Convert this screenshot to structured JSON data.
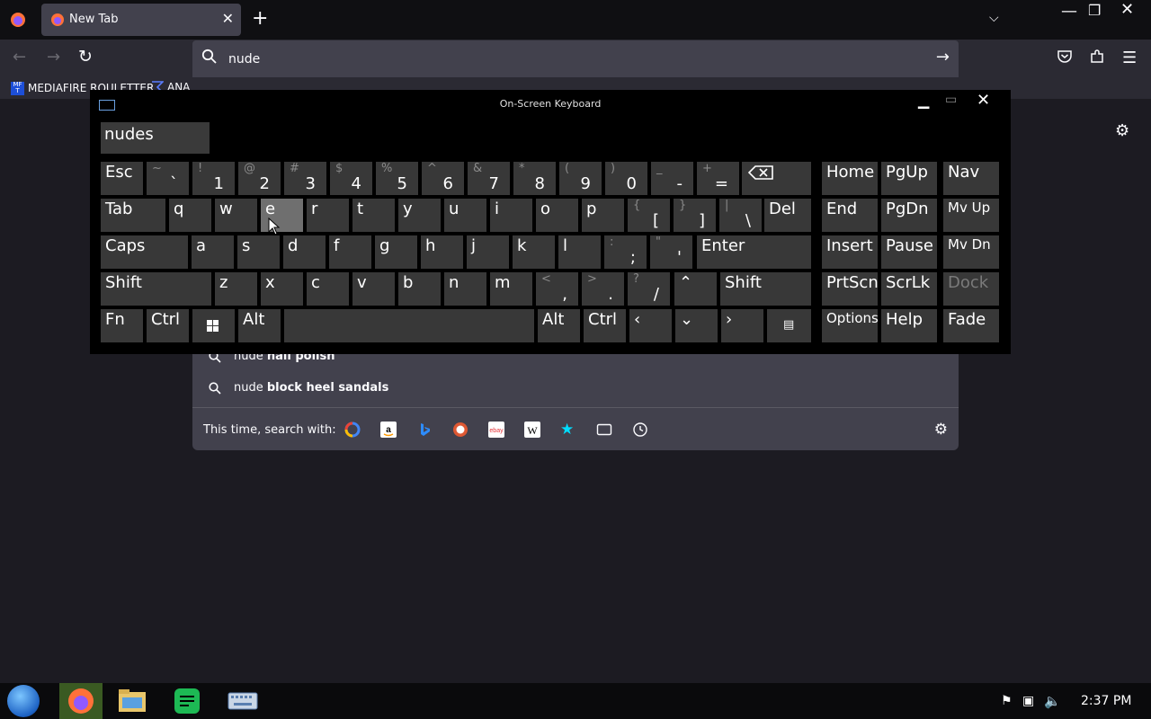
{
  "browser": {
    "tab_title": "New Tab",
    "tab_close": "✕",
    "new_tab": "+",
    "url_value": "nude",
    "url_go": "→",
    "bookmarks": [
      "MEDIAFIRE ROULETTER",
      "ANA"
    ],
    "bookmark_icon_text": "MF T"
  },
  "window_controls": {
    "min": "—",
    "max": "❐",
    "close": "✕"
  },
  "suggestions": [
    {
      "prefix": "nude",
      "bold": "nail polish"
    },
    {
      "prefix": "nude",
      "bold": "block heel sandals"
    }
  ],
  "search_with_label": "This time, search with:",
  "engines": [
    "google-icon",
    "amazon-icon",
    "bing-icon",
    "duckduckgo-icon",
    "ebay-icon",
    "wikipedia-icon",
    "bookmarks-star-icon",
    "tabs-icon",
    "history-icon"
  ],
  "osk": {
    "title": "On-Screen Keyboard",
    "prediction": "nudes",
    "keys": {
      "esc": "Esc",
      "tab": "Tab",
      "caps": "Caps",
      "shift": "Shift",
      "fn": "Fn",
      "ctrl": "Ctrl",
      "alt": "Alt",
      "del": "Del",
      "enter": "Enter",
      "home": "Home",
      "pgup": "PgUp",
      "nav": "Nav",
      "end": "End",
      "pgdn": "PgDn",
      "mvup": "Mv Up",
      "insert": "Insert",
      "pause": "Pause",
      "mvdn": "Mv Dn",
      "prtscn": "PrtScn",
      "scrlk": "ScrLk",
      "dock": "Dock",
      "options": "Options",
      "help": "Help",
      "fade": "Fade",
      "row1_shift": [
        "~",
        "!",
        "@",
        "#",
        "$",
        "%",
        "^",
        "&",
        "*",
        "(",
        ")",
        "_",
        "+"
      ],
      "row1_main": [
        "`",
        "1",
        "2",
        "3",
        "4",
        "5",
        "6",
        "7",
        "8",
        "9",
        "0",
        "-",
        "="
      ],
      "row2": [
        "q",
        "w",
        "e",
        "r",
        "t",
        "y",
        "u",
        "i",
        "o",
        "p"
      ],
      "row2_sym_shift": [
        "{",
        "}",
        "|"
      ],
      "row2_sym": [
        "[",
        "]",
        "\\"
      ],
      "row3": [
        "a",
        "s",
        "d",
        "f",
        "g",
        "h",
        "j",
        "k",
        "l"
      ],
      "row3_sym_shift": [
        ":",
        "\""
      ],
      "row3_sym": [
        ";",
        "'"
      ],
      "row4": [
        "z",
        "x",
        "c",
        "v",
        "b",
        "n",
        "m"
      ],
      "row4_sym_shift": [
        "<",
        ">",
        "?"
      ],
      "row4_sym": [
        ",",
        ".",
        "/"
      ]
    }
  },
  "taskbar": {
    "clock": "2:37 PM"
  },
  "colors": {
    "tab_bg": "#42414d",
    "toolbar": "#2b2a33",
    "key": "#383838",
    "key_highlight": "#6f6f6f"
  }
}
